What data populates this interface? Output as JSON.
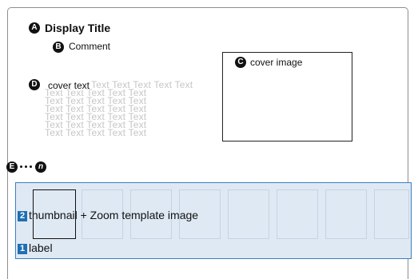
{
  "badges": {
    "a": "A",
    "b": "B",
    "c": "C",
    "d": "D",
    "e": "E",
    "n": "n",
    "one": "1",
    "two": "2"
  },
  "header": {
    "display_title": "Display Title",
    "comment": "Comment"
  },
  "cover": {
    "image_label": "cover image",
    "text_label": "cover text",
    "placeholder_lines": [
      "Text Text Text Text Text",
      "Text Text Text Text Text",
      "Text Text Text Text Text",
      "Text Text Text Text Text",
      "Text Text Text Text Text",
      "Text Text Text Text Text",
      "Text Text Text Text Text"
    ]
  },
  "strip": {
    "thumbnail_caption": "thumbnail + Zoom template image",
    "label": "label"
  }
}
